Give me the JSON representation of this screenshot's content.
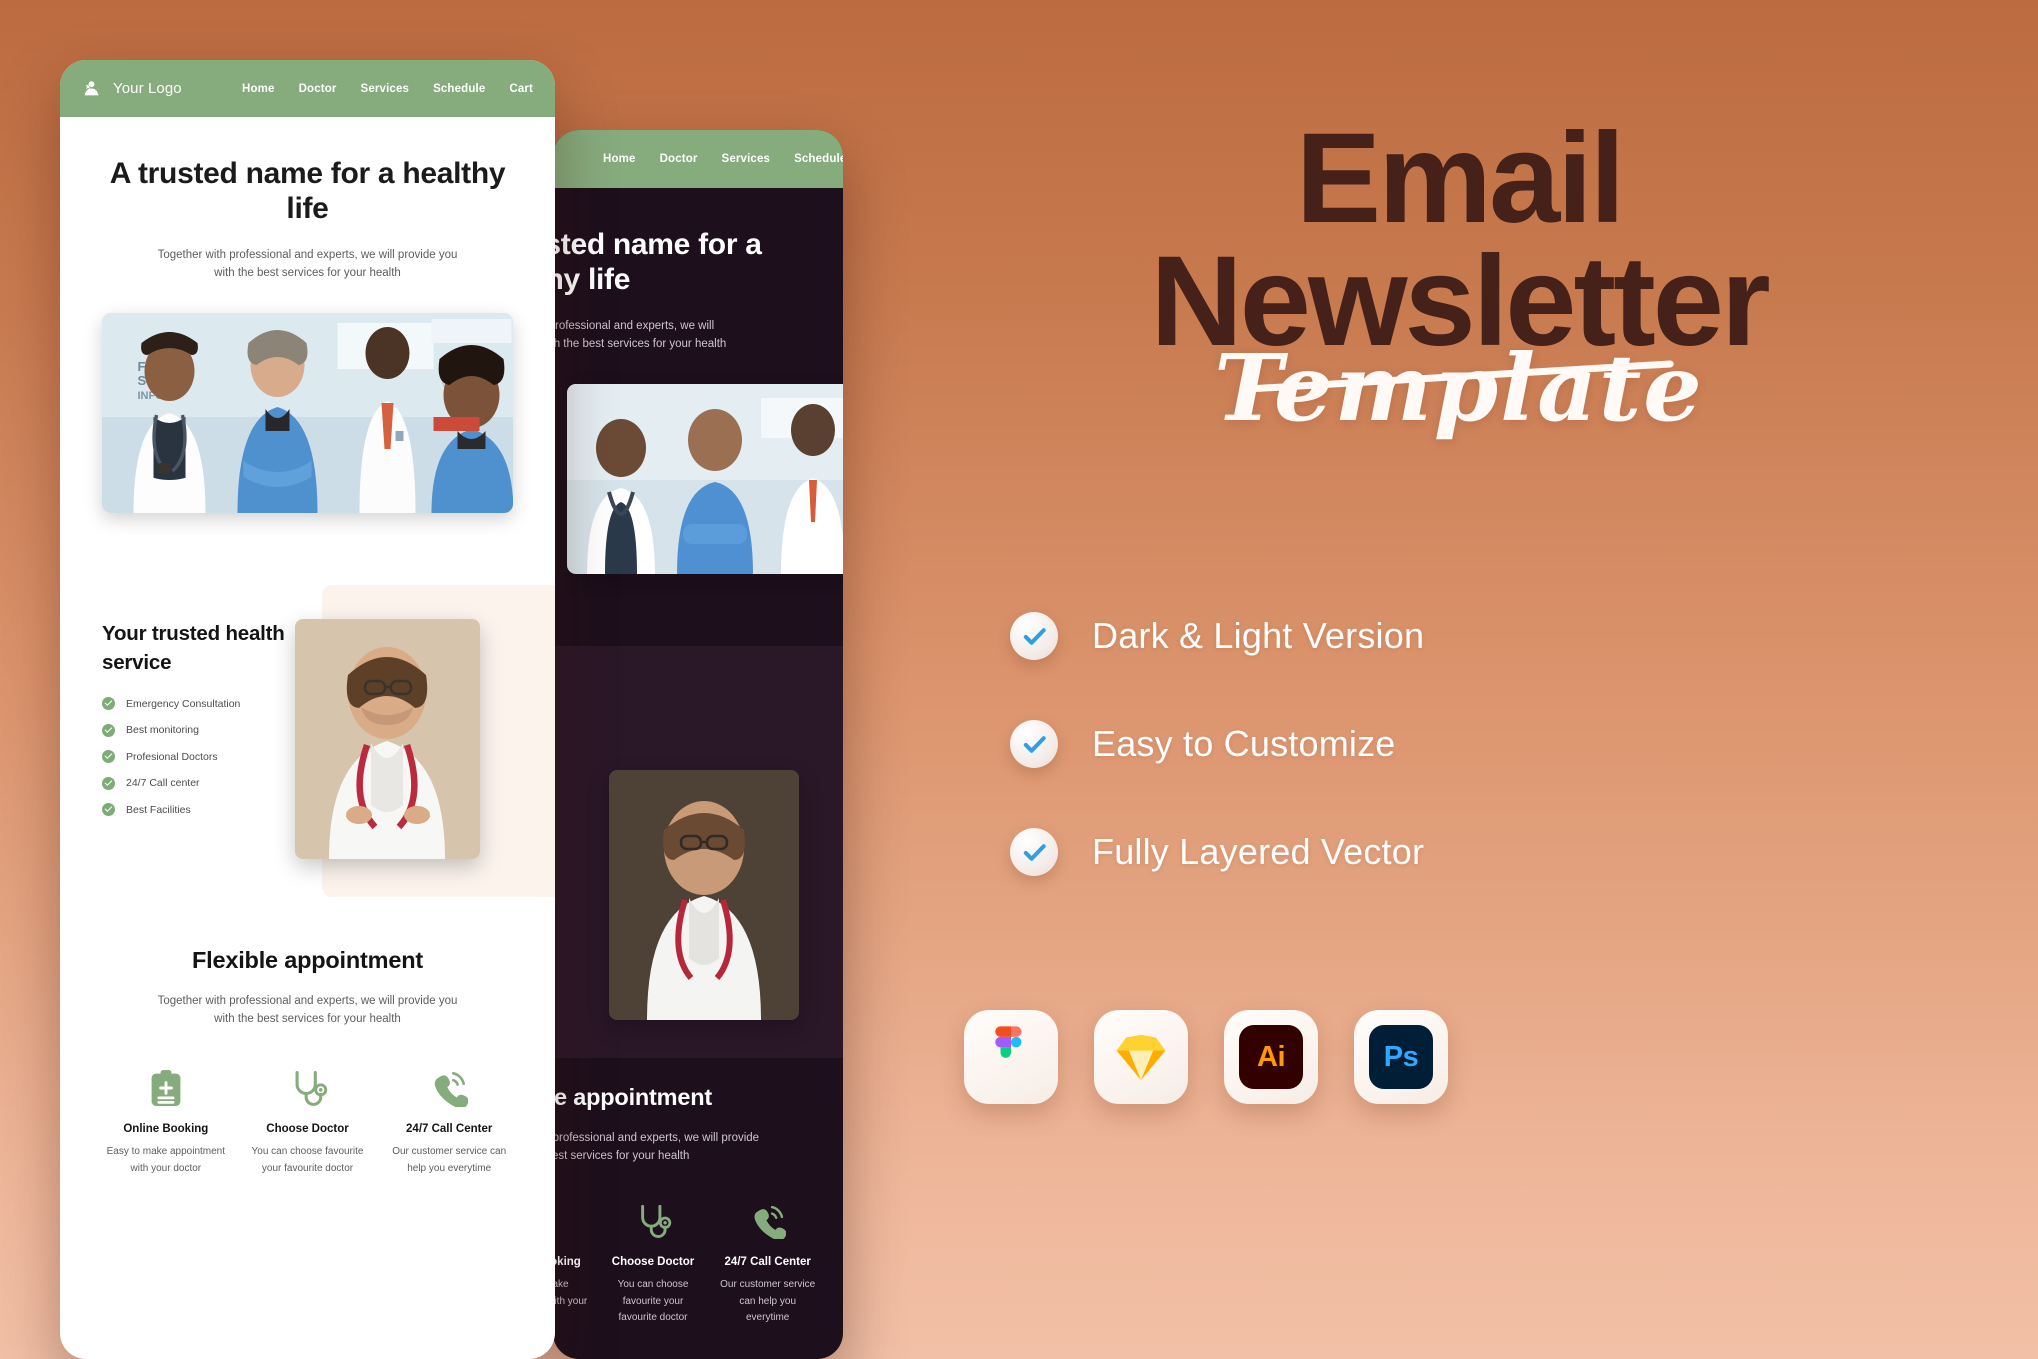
{
  "background": {
    "gradient_top": "#bc6b40",
    "gradient_bottom": "#f2c0a6"
  },
  "mockup": {
    "nav": {
      "brand": "Your Logo",
      "brand_icon": "medical-logo-icon",
      "links": [
        "Home",
        "Doctor",
        "Services",
        "Schedule",
        "Cart"
      ]
    },
    "hero": {
      "heading": "A trusted name for a healthy life",
      "subtext": "Together with professional and experts, we will provide you with the best services for your health",
      "photo_alt": "medical-team-photo"
    },
    "trusted": {
      "heading": "Your trusted health service",
      "items": [
        "Emergency Consultation",
        "Best monitoring",
        "Profesional Doctors",
        "24/7 Call center",
        "Best Facilities"
      ],
      "photo_alt": "female-doctor-photo"
    },
    "appointment": {
      "heading": "Flexible appointment",
      "subtext": "Together with professional and experts, we will provide you with the best services for your health",
      "cards": [
        {
          "icon": "clipboard-plus-icon",
          "title": "Online Booking",
          "desc": "Easy to make appointment with your doctor"
        },
        {
          "icon": "stethoscope-icon",
          "title": "Choose Doctor",
          "desc": "You can choose favourite your favourite doctor"
        },
        {
          "icon": "phone-call-icon",
          "title": "24/7 Call Center",
          "desc": "Our customer service can help you everytime"
        }
      ]
    },
    "accent_green": "#86ab7d",
    "dark_bg": "#1d0f1c",
    "light_bg": "#ffffff"
  },
  "promo": {
    "title_line_1": "Email",
    "title_line_2": "Newsletter",
    "title_script": "Template",
    "title_color": "#46211a",
    "script_color": "#fffaf6",
    "features": [
      {
        "label": "Dark & Light Version",
        "icon": "check-circle-icon"
      },
      {
        "label": "Easy to Customize",
        "icon": "check-circle-icon"
      },
      {
        "label": "Fully Layered Vector",
        "icon": "check-circle-icon"
      }
    ],
    "check_color": "#2f9fe3",
    "apps": [
      {
        "name": "figma-icon",
        "label": ""
      },
      {
        "name": "sketch-icon",
        "label": ""
      },
      {
        "name": "illustrator-icon",
        "label": "Ai"
      },
      {
        "name": "photoshop-icon",
        "label": "Ps"
      }
    ]
  }
}
